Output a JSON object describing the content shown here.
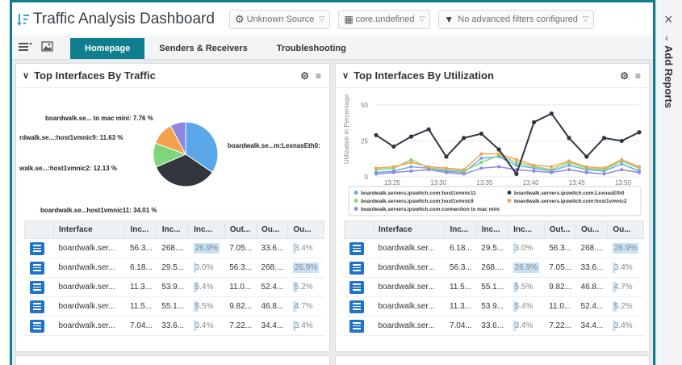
{
  "header": {
    "title": "Traffic Analysis Dashboard",
    "source": "Unknown Source",
    "date": "core.undefined",
    "filter": "No advanced filters configured"
  },
  "tabs": [
    {
      "label": "Homepage"
    },
    {
      "label": "Senders & Receivers"
    },
    {
      "label": "Troubleshooting"
    }
  ],
  "sidebar": {
    "add_reports": "Add Reports",
    "close": "×"
  },
  "panel_left": {
    "title": "Top Interfaces By Traffic",
    "pie_labels": [
      "boardwalk.se... to mac mini: 7.76 %",
      "rdwalk.se...:host1vmnic9: 11.63 %",
      "walk.se...:host1vmnic2: 12.13 %",
      "boardwalk.se...host1vmnic11: 34.01 %",
      "boardwalk.se...m:LexnasEth0:"
    ],
    "columns": [
      "Interface",
      "Inc...",
      "Inc...",
      "Inc...",
      "Out...",
      "Ou...",
      "Ou..."
    ],
    "rows": [
      [
        "boardwalk.ser...",
        "56.3...",
        "268....",
        "26.9%",
        "7.05...",
        "33.6...",
        "3.4%"
      ],
      [
        "boardwalk.ser...",
        "6.18...",
        "29.5...",
        "3.0%",
        "56.3...",
        "268....",
        "26.9%"
      ],
      [
        "boardwalk.ser...",
        "11.3...",
        "53.9...",
        "5.4%",
        "11.0...",
        "52.4...",
        "5.2%"
      ],
      [
        "boardwalk.ser...",
        "11.5...",
        "55.1...",
        "5.5%",
        "9.82...",
        "46.8...",
        "4.7%"
      ],
      [
        "boardwalk.ser...",
        "7.04...",
        "33.6...",
        "3.4%",
        "7.22...",
        "34.4...",
        "3.4%"
      ]
    ]
  },
  "panel_right": {
    "title": "Top Interfaces By Utilization",
    "ylabel": "Utilization in Percentage",
    "legend": [
      "boardwalk.servers.ipswitch.com:host1vmnic11",
      "boardwalk.servers.ipswitch.com:LexnasEth0",
      "boardwalk.servers.ipswitch.com:host1vmnic9",
      "boardwalk.servers.ipswitch.com:host1vmnic2",
      "boardwalk.servers.ipswitch.com:connection to mac mini"
    ],
    "columns": [
      "Interface",
      "Inc...",
      "Inc...",
      "Inc...",
      "Out...",
      "Ou...",
      "Ou..."
    ],
    "rows": [
      [
        "boardwalk.ser...",
        "6.18...",
        "29.5...",
        "3.0%",
        "56.3...",
        "268....",
        "26.9%"
      ],
      [
        "boardwalk.ser...",
        "56.3...",
        "268....",
        "26.9%",
        "7.05...",
        "33.6...",
        "3.4%"
      ],
      [
        "boardwalk.ser...",
        "11.5...",
        "55.1...",
        "5.5%",
        "9.82...",
        "46.8...",
        "4.7%"
      ],
      [
        "boardwalk.ser...",
        "11.3...",
        "53.9...",
        "5.4%",
        "11.0...",
        "52.4...",
        "5.2%"
      ],
      [
        "boardwalk.ser...",
        "7.04...",
        "33.6...",
        "3.4%",
        "7.22...",
        "34.4...",
        "3.4%"
      ]
    ]
  },
  "chart_data": [
    {
      "type": "pie",
      "slices": [
        {
          "label": "boardwalk.se...m:LexnasEth0:",
          "value": 34.46,
          "color": "#5aa7ea"
        },
        {
          "label": "boardwalk.se...host1vmnic11: 34.01 %",
          "value": 34.01,
          "color": "#33363c"
        },
        {
          "label": "walk.se...:host1vmnic2: 12.13 %",
          "value": 12.13,
          "color": "#7fd67a"
        },
        {
          "label": "rdwalk.se...:host1vmnic9: 11.63 %",
          "value": 11.63,
          "color": "#f5a14b"
        },
        {
          "label": "boardwalk.se... to mac mini: 7.76 %",
          "value": 7.76,
          "color": "#8f86e0"
        }
      ]
    },
    {
      "type": "line",
      "ylim": [
        0,
        55
      ],
      "yticks": [
        0,
        25,
        50
      ],
      "xticks": [
        "13:25",
        "13:30",
        "13:35",
        "13:40",
        "13:45",
        "13:50"
      ],
      "x": [
        0,
        1,
        2,
        3,
        4,
        5,
        6,
        7,
        8,
        9,
        10,
        11,
        12,
        13,
        14,
        15
      ],
      "series": [
        {
          "name": "boardwalk.servers.ipswitch.com:LexnasEth0",
          "color": "#2e3440",
          "values": [
            29,
            21,
            28,
            33,
            14,
            27,
            30,
            19,
            2,
            38,
            44,
            27,
            14,
            27,
            25,
            31
          ]
        },
        {
          "name": "boardwalk.servers.ipswitch.com:host1vmnic11",
          "color": "#6aa9e6",
          "values": [
            3,
            4,
            7,
            6,
            4,
            3,
            13,
            14,
            8,
            6,
            4,
            8,
            5,
            4,
            9,
            4
          ]
        },
        {
          "name": "boardwalk.servers.ipswitch.com:host1vmnic9",
          "color": "#7fd67a",
          "values": [
            5,
            6,
            12,
            6,
            5,
            4,
            10,
            15,
            10,
            7,
            5,
            10,
            6,
            5,
            11,
            6
          ]
        },
        {
          "name": "boardwalk.servers.ipswitch.com:host1vmnic2",
          "color": "#f5a14b",
          "values": [
            6,
            7,
            10,
            7,
            6,
            5,
            16,
            16,
            12,
            8,
            7,
            11,
            7,
            6,
            12,
            7
          ]
        },
        {
          "name": "boardwalk.servers.ipswitch.com:connection to mac mini",
          "color": "#8f86e0",
          "values": [
            2,
            3,
            4,
            5,
            3,
            2,
            6,
            7,
            5,
            4,
            3,
            5,
            3,
            2,
            5,
            3
          ]
        }
      ]
    }
  ]
}
